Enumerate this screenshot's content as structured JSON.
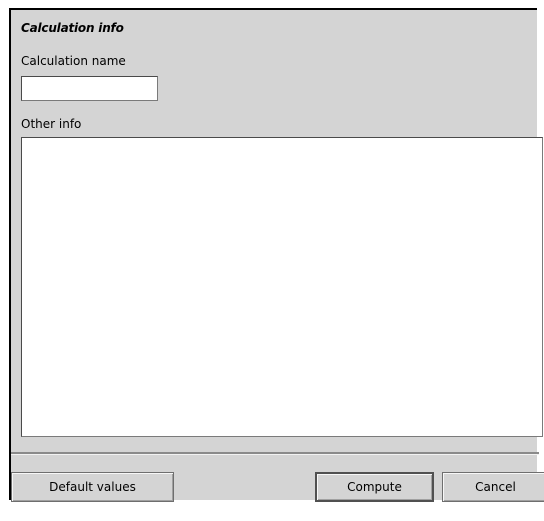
{
  "section": {
    "title": "Calculation info"
  },
  "fields": {
    "name_label": "Calculation name",
    "name_value": "",
    "other_label": "Other info",
    "other_value": ""
  },
  "buttons": {
    "default_label": "Default values",
    "compute_label": "Compute",
    "cancel_label": "Cancel"
  }
}
